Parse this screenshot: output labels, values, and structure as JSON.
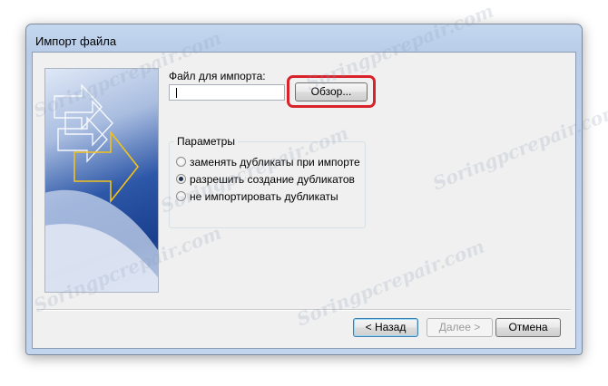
{
  "window": {
    "title": "Импорт файла"
  },
  "form": {
    "file_label": "Файл для импорта:",
    "file_value": "",
    "browse_label": "Обзор..."
  },
  "options": {
    "group_title": "Параметры",
    "items": [
      {
        "label": "заменять дубликаты при импорте",
        "checked": false
      },
      {
        "label": "разрешить создание дубликатов",
        "checked": true
      },
      {
        "label": "не импортировать дубликаты",
        "checked": false
      }
    ]
  },
  "footer": {
    "back_label": "< Назад",
    "next_label": "Далее >",
    "cancel_label": "Отмена"
  },
  "watermark": "Soringpcrepair.com",
  "colors": {
    "highlight": "#d8232a",
    "title_bar": "#b9cde9"
  }
}
